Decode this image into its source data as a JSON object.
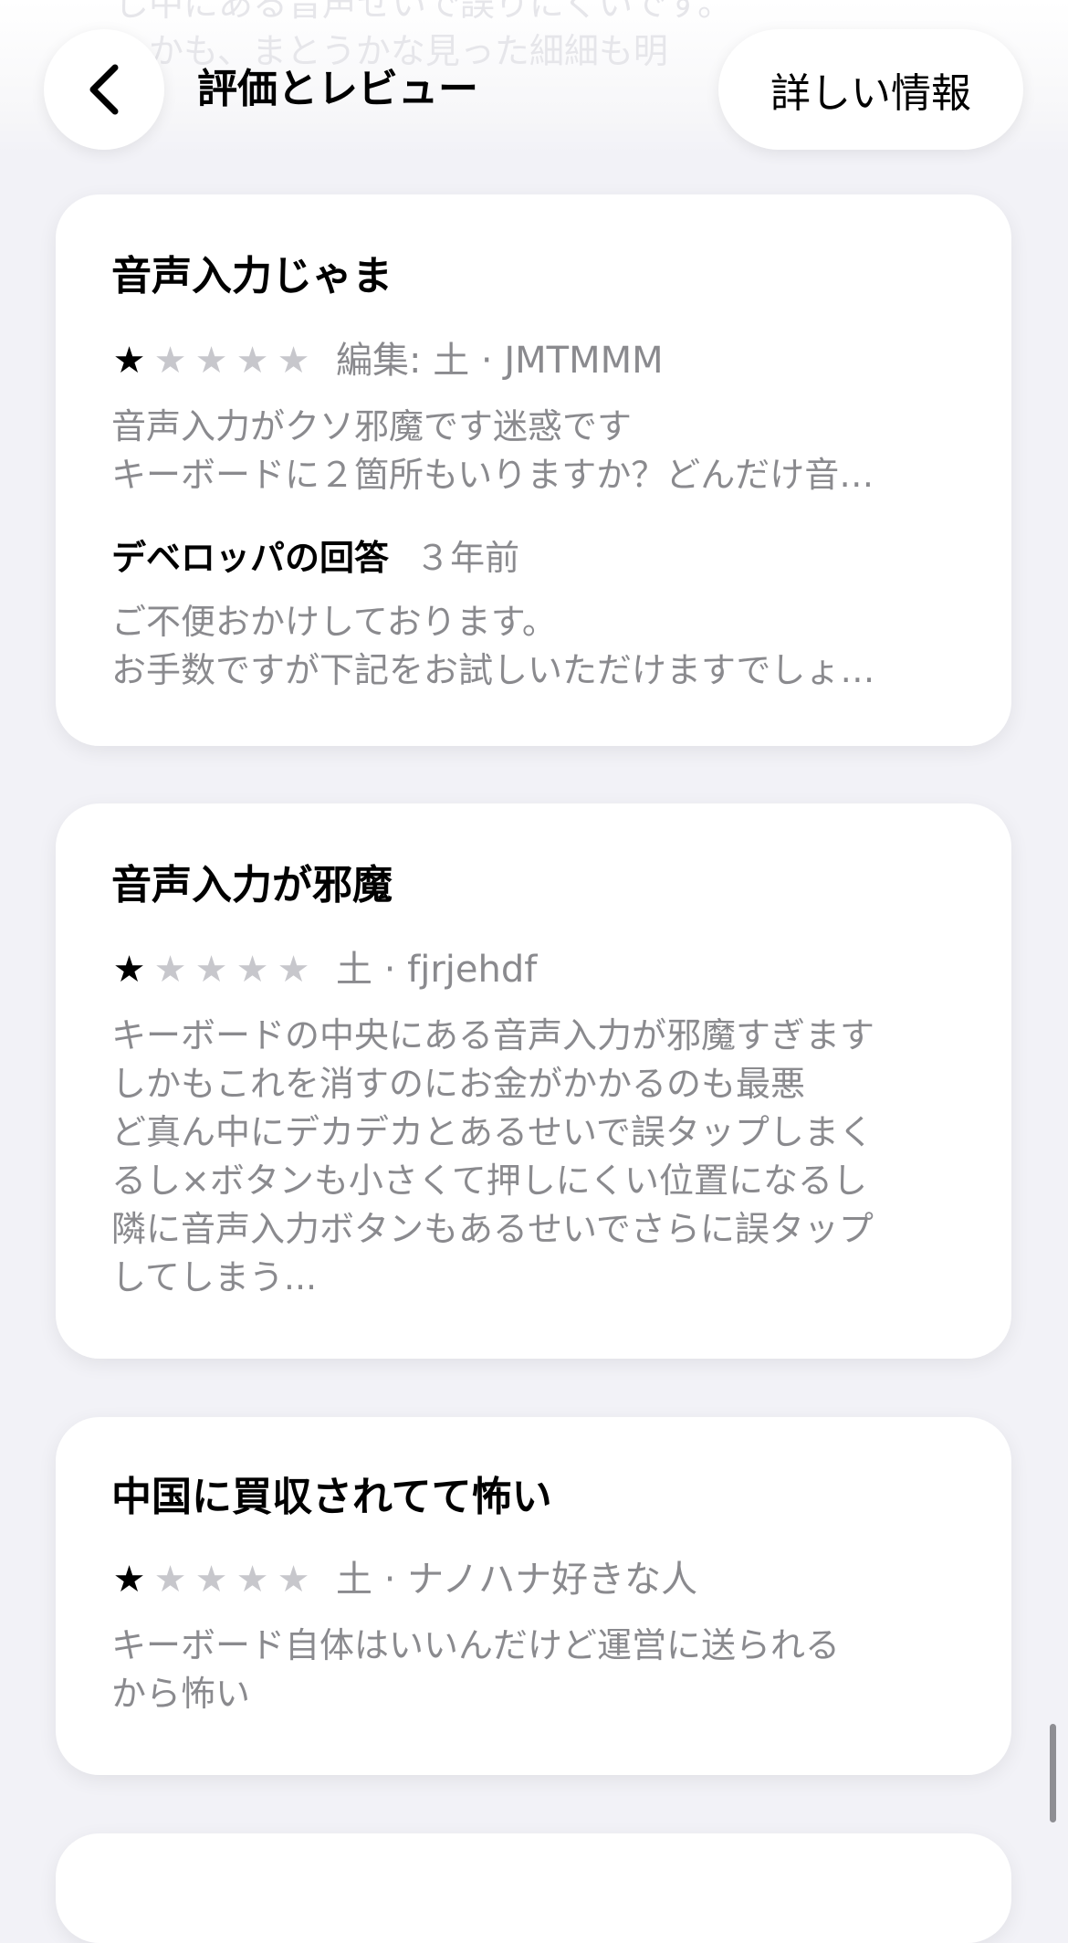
{
  "background": {
    "ghost_lines": [
      "し中にある音声せいで誤りにくいです。",
      "しかも、まとうかな見った細細も明"
    ]
  },
  "nav": {
    "back_icon": "chevron-left-icon",
    "title": "評価とレビュー",
    "more_info_label": "詳しい情報"
  },
  "colors": {
    "background": "#f2f2f7",
    "card": "#ffffff",
    "secondary_text": "#8a8a8e",
    "empty_star": "#c7c7cc"
  },
  "reviews": [
    {
      "title": "音声入力じゃま",
      "rating": 1,
      "max_rating": 5,
      "meta": "編集: 土 · JMTMMM",
      "body_lines": [
        "音声入力がクソ邪魔です迷惑です",
        "キーボードに２箇所もいりますか？どんだけ音…"
      ],
      "developer_response": {
        "label": "デベロッパの回答",
        "date": "３年前",
        "body_lines": [
          "ご不便おかけしております。",
          "お手数ですが下記をお試しいただけますでしょ…"
        ]
      }
    },
    {
      "title": "音声入力が邪魔",
      "rating": 1,
      "max_rating": 5,
      "meta": "土 · fjrjehdf",
      "body_lines": [
        "キーボードの中央にある音声入力が邪魔すぎます",
        "しかもこれを消すのにお金がかかるのも最悪",
        "ど真ん中にデカデカとあるせいで誤タップしまく",
        "るし×ボタンも小さくて押しにくい位置になるし",
        "隣に音声入力ボタンもあるせいでさらに誤タップ",
        "してしまう..."
      ]
    },
    {
      "title": "中国に買収されてて怖い",
      "rating": 1,
      "max_rating": 5,
      "meta": "土 · ナノハナ好きな人",
      "body_lines": [
        "キーボード自体はいいんだけど運営に送られる",
        "から怖い"
      ]
    }
  ]
}
